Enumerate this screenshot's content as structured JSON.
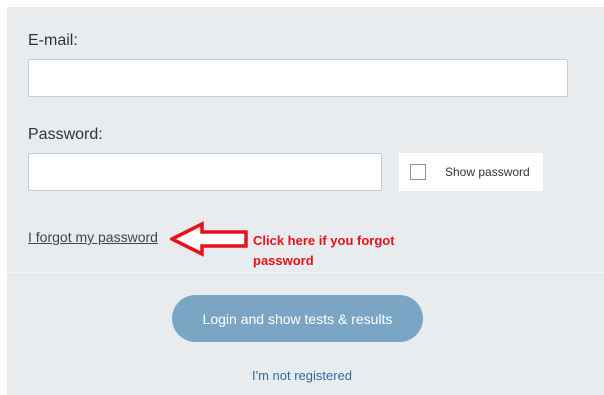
{
  "form": {
    "email_label": "E-mail:",
    "email_value": "",
    "email_placeholder": "",
    "password_label": "Password:",
    "password_value": "",
    "password_placeholder": "",
    "show_password_label": "Show password",
    "show_password_checked": false,
    "forgot_link": "I forgot my password",
    "login_button": "Login and show tests & results",
    "register_link": "I'm not registered"
  },
  "annotation": {
    "text_line1": "Click here if you forgot",
    "text_line2": "password",
    "arrow_icon": "left-arrow-outline-icon",
    "color": "#e8101a"
  },
  "colors": {
    "panel_background": "#e9ecee",
    "button_background": "#7ba5c4",
    "link_color": "#2f6aa3"
  }
}
